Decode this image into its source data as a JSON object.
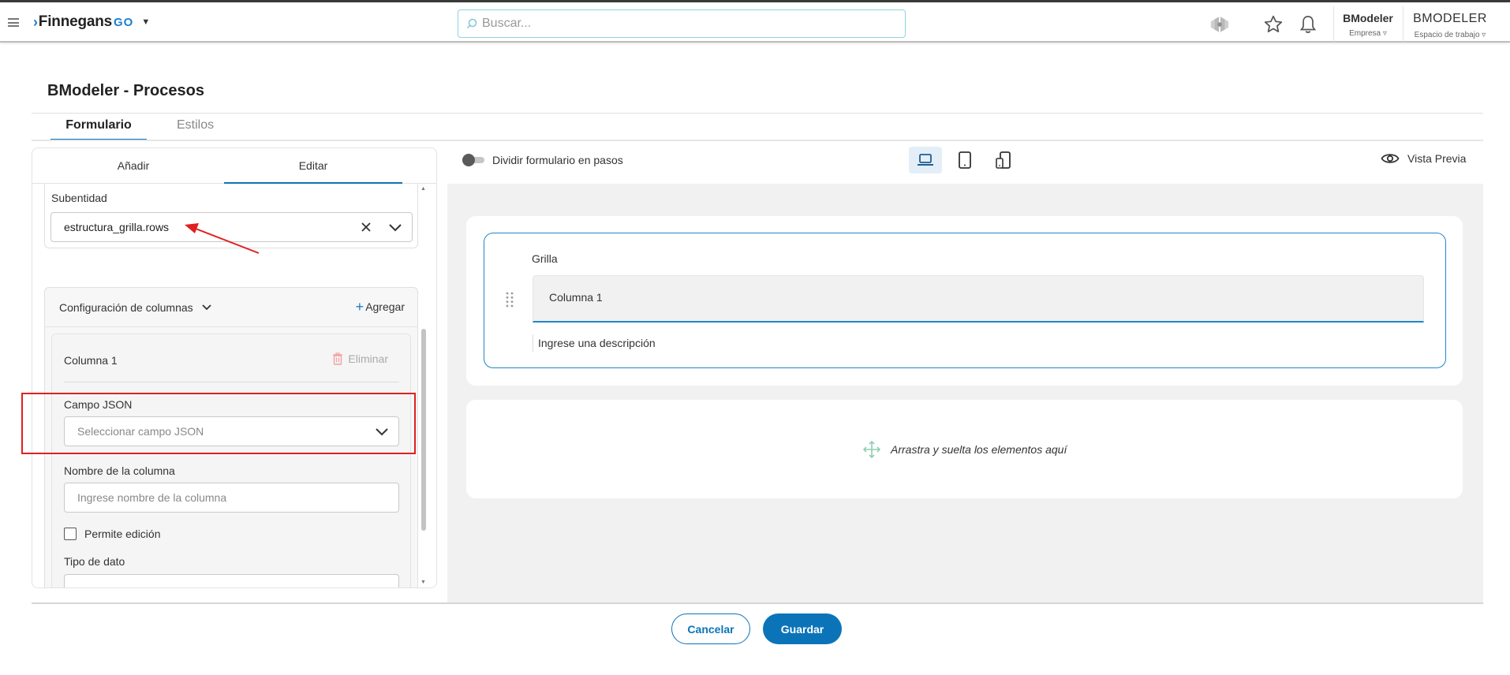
{
  "header": {
    "logo_text": "Finnegans",
    "logo_suffix": "GO",
    "search_placeholder": "Buscar...",
    "company_name": "BModeler",
    "company_label": "Empresa",
    "workspace_name": "BMODELER",
    "workspace_label": "Espacio de trabajo"
  },
  "page": {
    "title": "BModeler - Procesos",
    "tabs": [
      {
        "label": "Formulario",
        "active": true
      },
      {
        "label": "Estilos",
        "active": false
      }
    ]
  },
  "left_panel": {
    "tabs": [
      {
        "label": "Añadir",
        "active": false
      },
      {
        "label": "Editar",
        "active": true
      }
    ],
    "subentity": {
      "label": "Subentidad",
      "value": "estructura_grilla.rows"
    },
    "columns_config": {
      "title": "Configuración de columnas",
      "add_label": "Agregar",
      "column": {
        "name": "Columna 1",
        "delete_label": "Eliminar",
        "json_field": {
          "label": "Campo JSON",
          "placeholder": "Seleccionar campo JSON"
        },
        "column_name": {
          "label": "Nombre de la columna",
          "placeholder": "Ingrese nombre de la columna"
        },
        "editable_label": "Permite edición",
        "editable_checked": false,
        "data_type": {
          "label": "Tipo de dato"
        }
      }
    }
  },
  "right_panel": {
    "split_steps_label": "Dividir formulario en pasos",
    "split_steps_on": false,
    "devices": [
      "laptop-icon",
      "tablet-icon",
      "mobile-rotate-icon"
    ],
    "active_device": "laptop-icon",
    "preview_label": "Vista Previa",
    "grid": {
      "label": "Grilla",
      "column_header": "Columna 1",
      "description": "Ingrese una descripción"
    },
    "drop_hint": "Arrastra y suelta los elementos aquí"
  },
  "footer": {
    "cancel_label": "Cancelar",
    "save_label": "Guardar"
  },
  "colors": {
    "primary": "#0b74b8",
    "accent_blue": "#1f87c9",
    "annotation_red": "#e02020",
    "delete_icon": "#f2a0a0"
  }
}
